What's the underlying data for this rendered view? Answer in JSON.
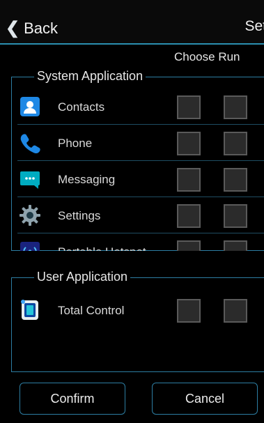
{
  "header": {
    "back_label": "Back",
    "title": "Set"
  },
  "columns": {
    "label": "Choose Run"
  },
  "system_group": {
    "title": "System Application",
    "items": [
      {
        "label": "Contacts",
        "icon": "contacts-icon",
        "choose": false,
        "run": false
      },
      {
        "label": "Phone",
        "icon": "phone-icon",
        "choose": false,
        "run": false
      },
      {
        "label": "Messaging",
        "icon": "messaging-icon",
        "choose": false,
        "run": false
      },
      {
        "label": "Settings",
        "icon": "settings-gear-icon",
        "choose": false,
        "run": false
      },
      {
        "label": "Portable Hotspot",
        "icon": "hotspot-icon",
        "choose": false,
        "run": false
      }
    ]
  },
  "user_group": {
    "title": "User Application",
    "items": [
      {
        "label": "Total Control",
        "icon": "total-control-icon",
        "choose": false,
        "run": false
      }
    ]
  },
  "buttons": {
    "confirm": "Confirm",
    "cancel": "Cancel"
  },
  "colors": {
    "accent": "#2d7ea3",
    "background": "#000000"
  }
}
